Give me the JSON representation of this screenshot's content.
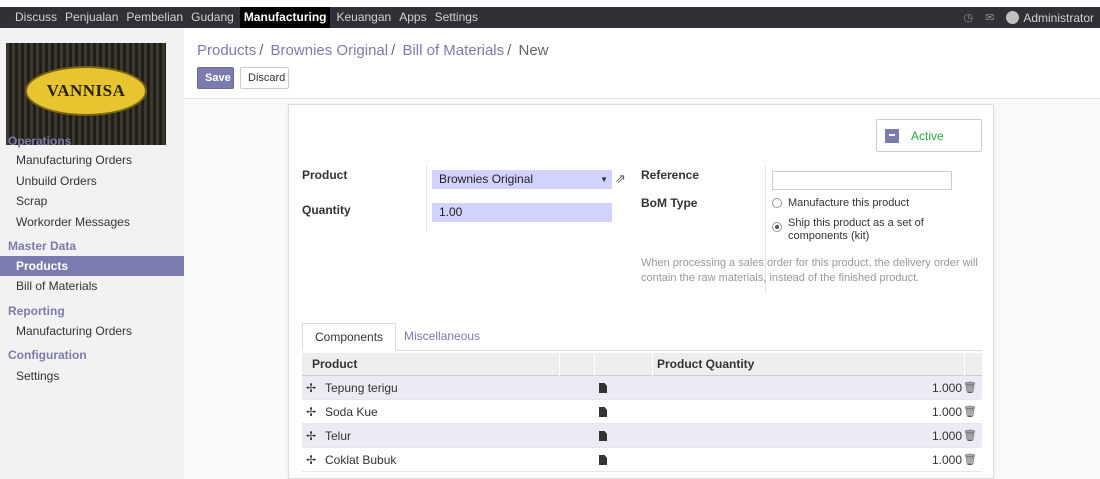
{
  "topbar": {
    "menu": [
      "Discuss",
      "Penjualan",
      "Pembelian",
      "Gudang",
      "Manufacturing",
      "Keuangan",
      "Apps",
      "Settings"
    ],
    "active_menu": "Manufacturing",
    "user": "Administrator"
  },
  "logo": {
    "text": "VANNISA"
  },
  "sidebar": {
    "operations_title": "Operations",
    "operations": [
      "Manufacturing Orders",
      "Unbuild Orders",
      "Scrap",
      "Workorder Messages"
    ],
    "master_title": "Master Data",
    "master": [
      "Products",
      "Bill of Materials"
    ],
    "reporting_title": "Reporting",
    "reporting": [
      "Manufacturing Orders"
    ],
    "config_title": "Configuration",
    "config": [
      "Settings"
    ]
  },
  "breadcrumb": {
    "part1": "Products",
    "part2": "Brownies Original",
    "part3": "Bill of Materials",
    "current": "New",
    "sep": "/"
  },
  "buttons": {
    "save": "Save",
    "discard": "Discard"
  },
  "status": {
    "active": "Active"
  },
  "form": {
    "product_label": "Product",
    "product_value": "Brownies Original",
    "quantity_label": "Quantity",
    "quantity_value": "1.00",
    "reference_label": "Reference",
    "reference_value": "",
    "bom_type_label": "BoM Type",
    "bom_options": [
      "Manufacture this product",
      "Ship this product as a set of components (kit)"
    ],
    "bom_selected": 1,
    "hint": "When processing a sales order for this product, the delivery order will contain the raw materials, instead of the finished product."
  },
  "tabs": [
    "Components",
    "Miscellaneous"
  ],
  "table": {
    "headers": {
      "product": "Product",
      "quantity": "Product Quantity"
    },
    "rows": [
      {
        "product": "Tepung terigu",
        "qty": "1.000"
      },
      {
        "product": "Soda Kue",
        "qty": "1.000"
      },
      {
        "product": "Telur",
        "qty": "1.000"
      },
      {
        "product": "Coklat Bubuk",
        "qty": "1.000"
      }
    ]
  }
}
